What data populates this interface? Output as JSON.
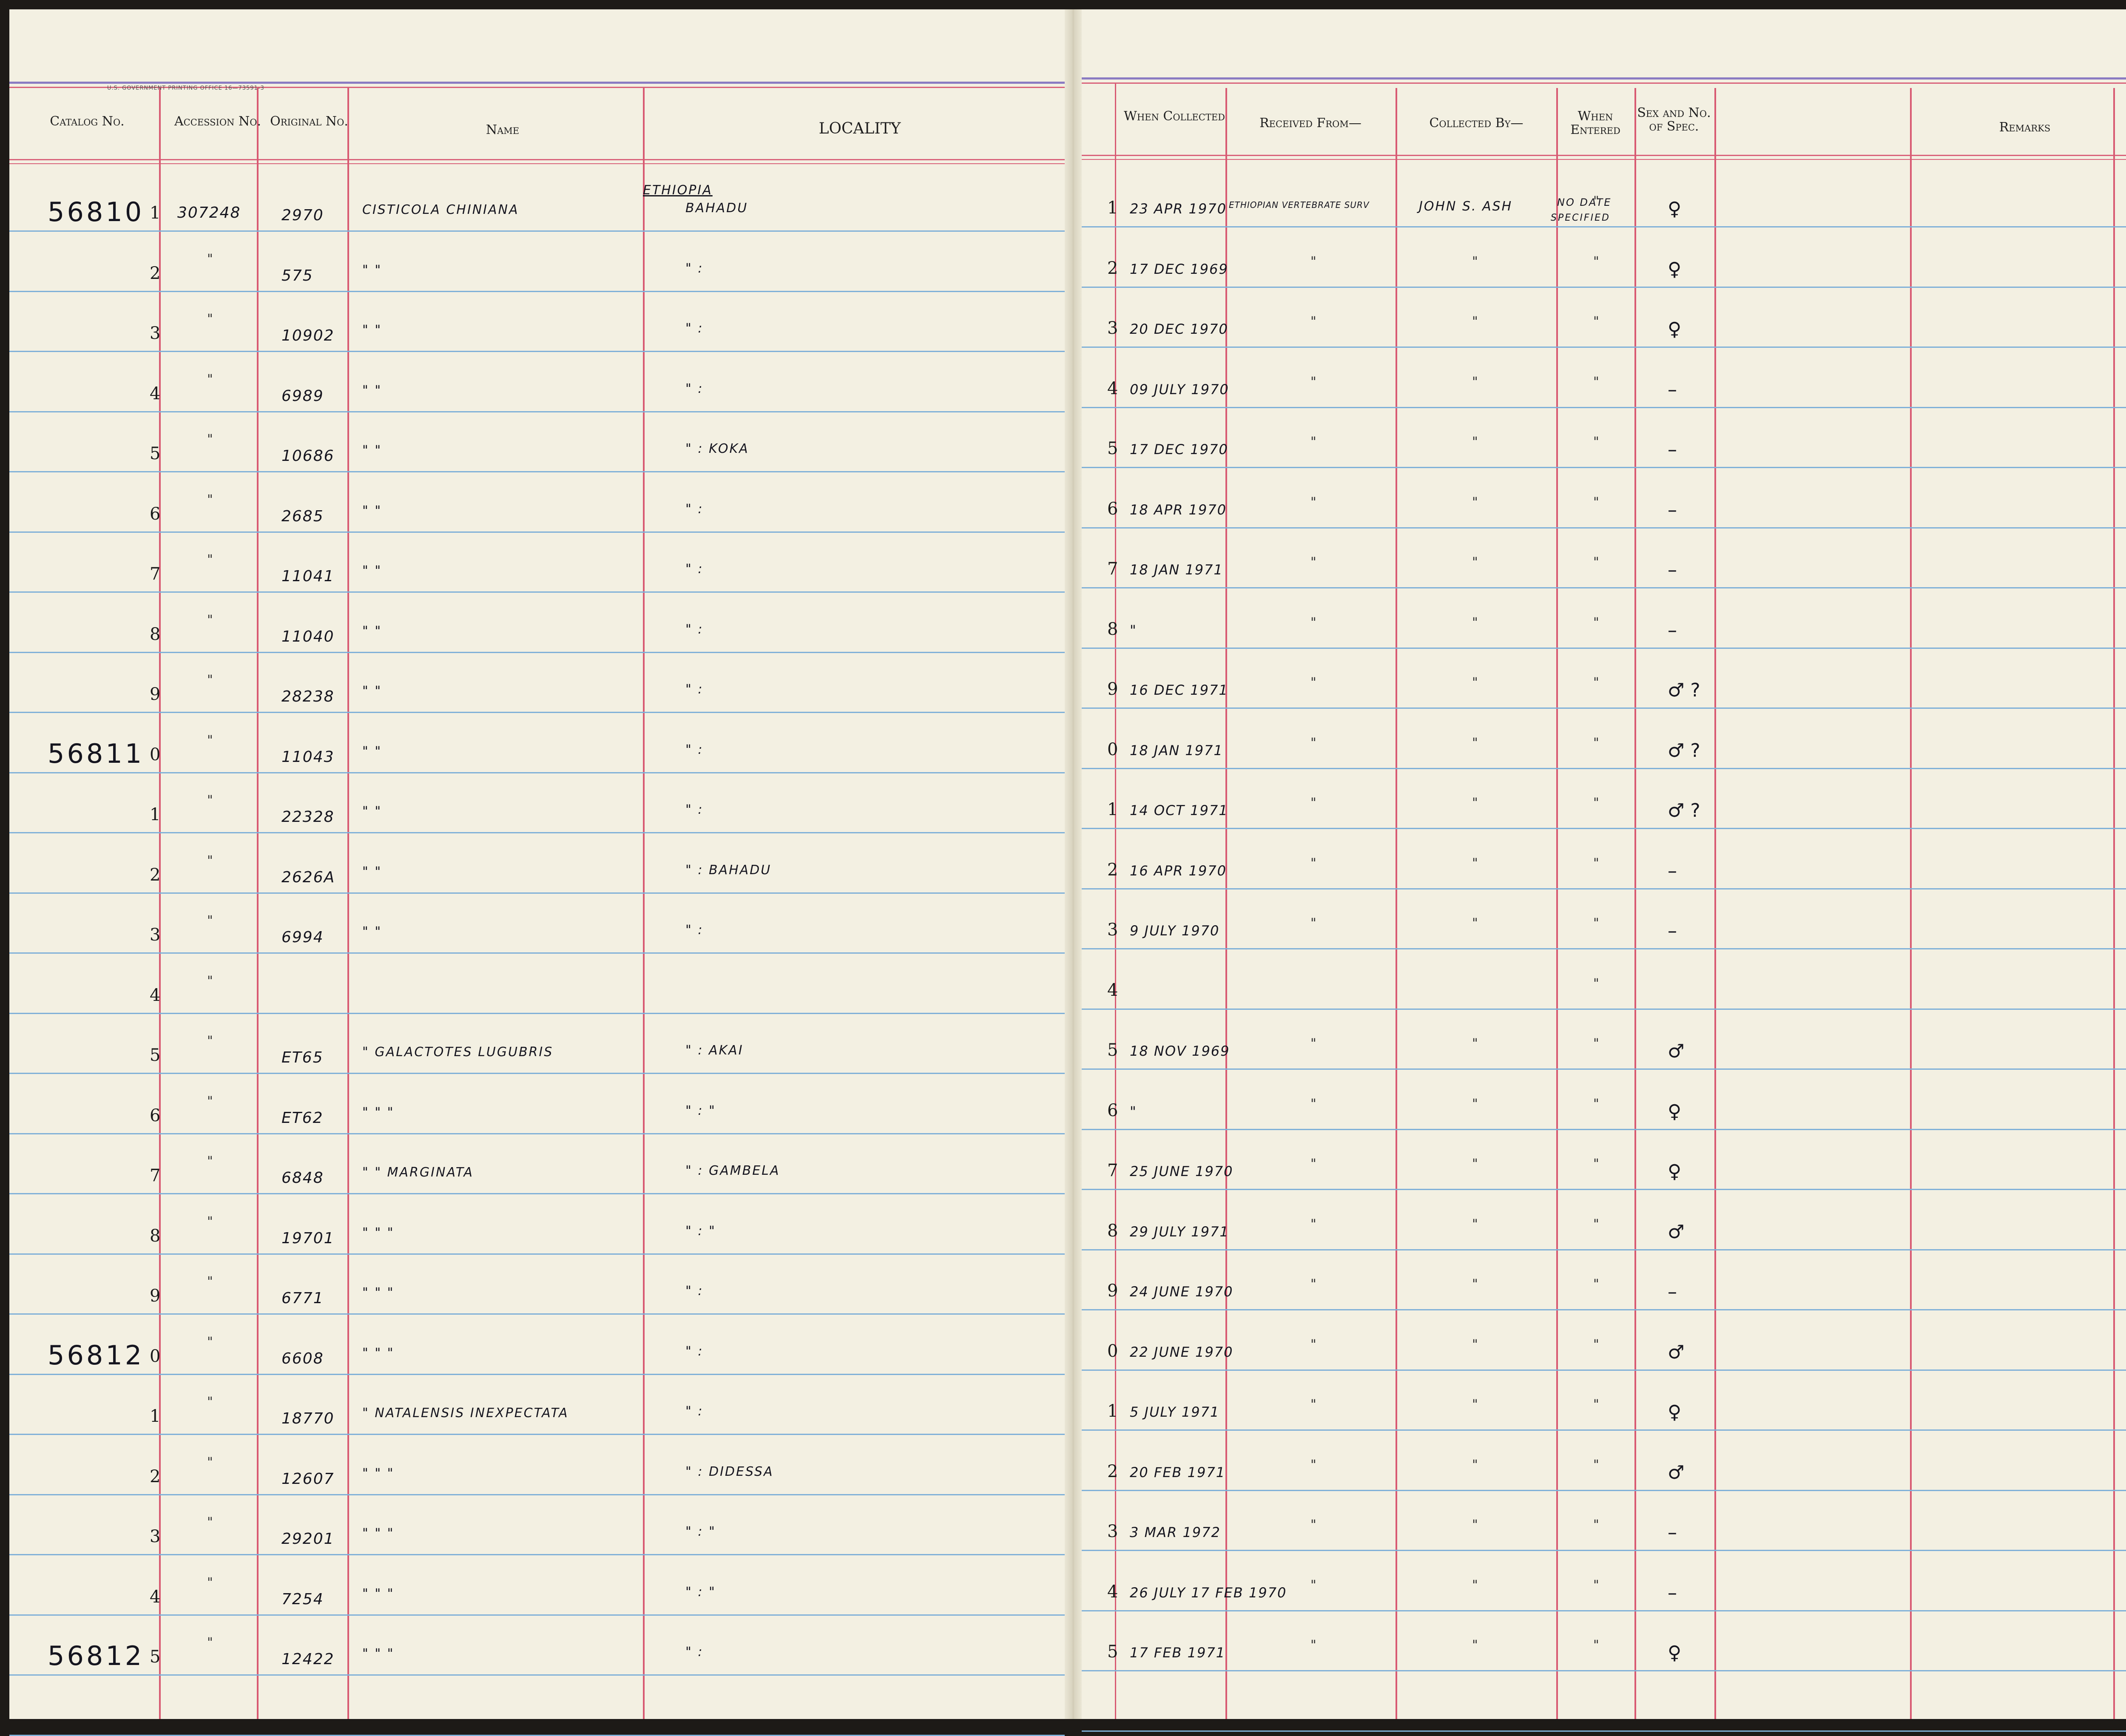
{
  "printer_note": "U.S. GOVERNMENT PRINTING OFFICE   16—73591-3",
  "headers": {
    "catalog": "Catalog No.",
    "accession": "Accession No.",
    "original": "Original No.",
    "name": "Name",
    "locality": "LOCALITY",
    "when_collected": "When Collected",
    "received_from": "Received From—",
    "collected_by": "Collected By—",
    "when_entered": "When Entered",
    "sex_spec": "Sex and No. of Spec.",
    "remarks": "Remarks"
  },
  "header_notes": {
    "ethiopia": "ETHIOPIA",
    "no_date": "NO DATE",
    "specified": "SPECIFIED"
  },
  "rows": [
    {
      "catalog": "56810",
      "num": "1",
      "acc": "307248",
      "orig": "2970",
      "name": "CISTICOLA CHINIANA",
      "loc": "BAHADU",
      "date": "23 APR 1970",
      "recv": "ETHIOPIAN VERTEBRATE SURV",
      "coll": "JOHN S. ASH",
      "sex": "♀"
    },
    {
      "catalog": "",
      "num": "2",
      "acc": "\"",
      "orig": "575",
      "name": "\"   \"",
      "loc": "\" :",
      "date": "17 DEC 1969",
      "recv": "\"",
      "coll": "\"",
      "sex": "♀"
    },
    {
      "catalog": "",
      "num": "3",
      "acc": "\"",
      "orig": "10902",
      "name": "\"   \"",
      "loc": "\" :",
      "date": "20 DEC 1970",
      "recv": "\"",
      "coll": "\"",
      "sex": "♀"
    },
    {
      "catalog": "",
      "num": "4",
      "acc": "\"",
      "orig": "6989",
      "name": "\"   \"",
      "loc": "\" :",
      "date": "09 JULY 1970",
      "recv": "\"",
      "coll": "\"",
      "sex": "–"
    },
    {
      "catalog": "",
      "num": "5",
      "acc": "\"",
      "orig": "10686",
      "name": "\"   \"",
      "loc": "\" : KOKA",
      "date": "17 DEC 1970",
      "recv": "\"",
      "coll": "\"",
      "sex": "–"
    },
    {
      "catalog": "",
      "num": "6",
      "acc": "\"",
      "orig": "2685",
      "name": "\"   \"",
      "loc": "\" :",
      "date": "18 APR 1970",
      "recv": "\"",
      "coll": "\"",
      "sex": "–"
    },
    {
      "catalog": "",
      "num": "7",
      "acc": "\"",
      "orig": "11041",
      "name": "\"   \"",
      "loc": "\" :",
      "date": "18 JAN 1971",
      "recv": "\"",
      "coll": "\"",
      "sex": "–"
    },
    {
      "catalog": "",
      "num": "8",
      "acc": "\"",
      "orig": "11040",
      "name": "\"   \"",
      "loc": "\" :",
      "date": "\"",
      "recv": "\"",
      "coll": "\"",
      "sex": "–"
    },
    {
      "catalog": "",
      "num": "9",
      "acc": "\"",
      "orig": "28238",
      "name": "\"   \"",
      "loc": "\" :",
      "date": "16 DEC 1971",
      "recv": "\"",
      "coll": "\"",
      "sex": "♂ ?"
    },
    {
      "catalog": "56811",
      "num": "0",
      "acc": "\"",
      "orig": "11043",
      "name": "\"   \"",
      "loc": "\" :",
      "date": "18 JAN 1971",
      "recv": "\"",
      "coll": "\"",
      "sex": "♂ ?"
    },
    {
      "catalog": "",
      "num": "1",
      "acc": "\"",
      "orig": "22328",
      "name": "\"   \"",
      "loc": "\" :",
      "date": "14 OCT 1971",
      "recv": "\"",
      "coll": "\"",
      "sex": "♂ ?"
    },
    {
      "catalog": "",
      "num": "2",
      "acc": "\"",
      "orig": "2626A",
      "name": "\"   \"",
      "loc": "\" : BAHADU",
      "date": "16 APR 1970",
      "recv": "\"",
      "coll": "\"",
      "sex": "–"
    },
    {
      "catalog": "",
      "num": "3",
      "acc": "\"",
      "orig": "6994",
      "name": "\"   \"",
      "loc": "\" :",
      "date": "9 JULY 1970",
      "recv": "\"",
      "coll": "\"",
      "sex": "–"
    },
    {
      "catalog": "",
      "num": "4",
      "acc": "\"",
      "orig": "",
      "name": "",
      "loc": "",
      "date": "",
      "recv": "",
      "coll": "",
      "sex": ""
    },
    {
      "catalog": "",
      "num": "5",
      "acc": "\"",
      "orig": "ET65",
      "name": "\"   GALACTOTES LUGUBRIS",
      "loc": "\" : AKAI",
      "date": "18 NOV 1969",
      "recv": "\"",
      "coll": "\"",
      "sex": "♂"
    },
    {
      "catalog": "",
      "num": "6",
      "acc": "\"",
      "orig": "ET62",
      "name": "\"   \"   \"",
      "loc": "\" :  \"",
      "date": "\"",
      "recv": "\"",
      "coll": "\"",
      "sex": "♀"
    },
    {
      "catalog": "",
      "num": "7",
      "acc": "\"",
      "orig": "6848",
      "name": "\"   \"   MARGINATA",
      "loc": "\" : GAMBELA",
      "date": "25 JUNE 1970",
      "recv": "\"",
      "coll": "\"",
      "sex": "♀"
    },
    {
      "catalog": "",
      "num": "8",
      "acc": "\"",
      "orig": "19701",
      "name": "\"   \"   \"",
      "loc": "\" :  \"",
      "date": "29 JULY 1971",
      "recv": "\"",
      "coll": "\"",
      "sex": "♂"
    },
    {
      "catalog": "",
      "num": "9",
      "acc": "\"",
      "orig": "6771",
      "name": "\"   \"   \"",
      "loc": "\" :",
      "date": "24 JUNE 1970",
      "recv": "\"",
      "coll": "\"",
      "sex": "–"
    },
    {
      "catalog": "56812",
      "num": "0",
      "acc": "\"",
      "orig": "6608",
      "name": "\"   \"   \"",
      "loc": "\" :",
      "date": "22 JUNE 1970",
      "recv": "\"",
      "coll": "\"",
      "sex": "♂"
    },
    {
      "catalog": "",
      "num": "1",
      "acc": "\"",
      "orig": "18770",
      "name": "\"   NATALENSIS INEXPECTATA",
      "loc": "\" :",
      "date": "5 JULY 1971",
      "recv": "\"",
      "coll": "\"",
      "sex": "♀"
    },
    {
      "catalog": "",
      "num": "2",
      "acc": "\"",
      "orig": "12607",
      "name": "\"   \"   \"",
      "loc": "\" : DIDESSA",
      "date": "20 FEB 1971",
      "recv": "\"",
      "coll": "\"",
      "sex": "♂"
    },
    {
      "catalog": "",
      "num": "3",
      "acc": "\"",
      "orig": "29201",
      "name": "\"   \"   \"",
      "loc": "\" :  \"",
      "date": "3 MAR 1972",
      "recv": "\"",
      "coll": "\"",
      "sex": "–"
    },
    {
      "catalog": "",
      "num": "4",
      "acc": "\"",
      "orig": "7254",
      "name": "\"   \"   \"",
      "loc": "\" :  \"",
      "date": "26 JULY 17 FEB 1970",
      "recv": "\"",
      "coll": "\"",
      "sex": "–"
    },
    {
      "catalog": "56812",
      "num": "5",
      "acc": "\"",
      "orig": "12422",
      "name": "\"   \"   \"",
      "loc": "\" :",
      "date": "17 FEB 1971",
      "recv": "\"",
      "coll": "\"",
      "sex": "♀"
    }
  ]
}
